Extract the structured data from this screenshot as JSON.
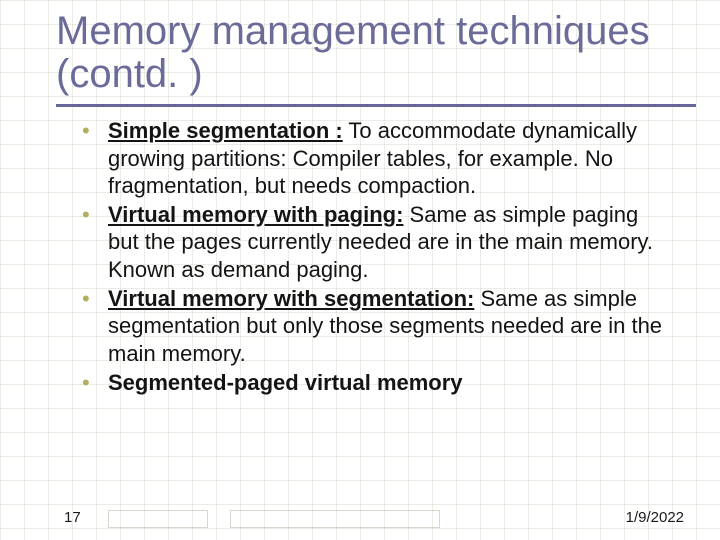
{
  "title": "Memory management techniques (contd. )",
  "bullets": [
    {
      "term": "Simple segmentation :",
      "body": " To accommodate dynamically growing partitions: Compiler tables, for example. No fragmentation, but needs compaction."
    },
    {
      "term": "Virtual memory with paging:",
      "body": " Same as simple paging but the pages currently needed are in the main memory. Known as demand paging."
    },
    {
      "term": "Virtual memory with segmentation:",
      "body": " Same as simple segmentation but only those segments needed are in the main memory."
    },
    {
      "term": "Segmented-paged virtual memory",
      "body": ""
    }
  ],
  "footer": {
    "slide_number": "17",
    "date": "1/9/2022"
  }
}
